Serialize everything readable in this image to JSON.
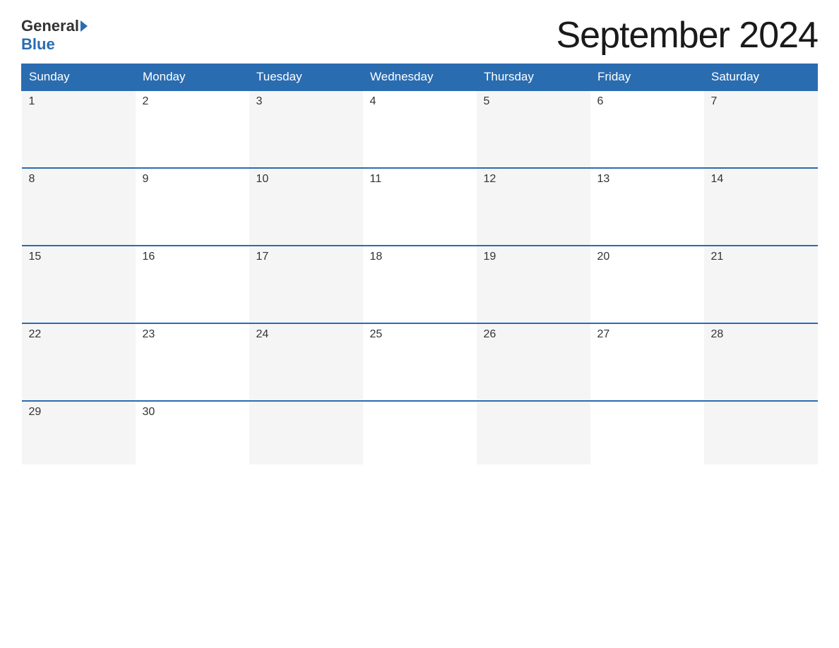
{
  "logo": {
    "general": "General",
    "blue": "Blue"
  },
  "title": "September 2024",
  "header": {
    "days": [
      "Sunday",
      "Monday",
      "Tuesday",
      "Wednesday",
      "Thursday",
      "Friday",
      "Saturday"
    ]
  },
  "weeks": [
    {
      "days": [
        {
          "date": "1",
          "empty": false
        },
        {
          "date": "2",
          "empty": false
        },
        {
          "date": "3",
          "empty": false
        },
        {
          "date": "4",
          "empty": false
        },
        {
          "date": "5",
          "empty": false
        },
        {
          "date": "6",
          "empty": false
        },
        {
          "date": "7",
          "empty": false
        }
      ]
    },
    {
      "days": [
        {
          "date": "8",
          "empty": false
        },
        {
          "date": "9",
          "empty": false
        },
        {
          "date": "10",
          "empty": false
        },
        {
          "date": "11",
          "empty": false
        },
        {
          "date": "12",
          "empty": false
        },
        {
          "date": "13",
          "empty": false
        },
        {
          "date": "14",
          "empty": false
        }
      ]
    },
    {
      "days": [
        {
          "date": "15",
          "empty": false
        },
        {
          "date": "16",
          "empty": false
        },
        {
          "date": "17",
          "empty": false
        },
        {
          "date": "18",
          "empty": false
        },
        {
          "date": "19",
          "empty": false
        },
        {
          "date": "20",
          "empty": false
        },
        {
          "date": "21",
          "empty": false
        }
      ]
    },
    {
      "days": [
        {
          "date": "22",
          "empty": false
        },
        {
          "date": "23",
          "empty": false
        },
        {
          "date": "24",
          "empty": false
        },
        {
          "date": "25",
          "empty": false
        },
        {
          "date": "26",
          "empty": false
        },
        {
          "date": "27",
          "empty": false
        },
        {
          "date": "28",
          "empty": false
        }
      ]
    },
    {
      "days": [
        {
          "date": "29",
          "empty": false
        },
        {
          "date": "30",
          "empty": false
        },
        {
          "date": "",
          "empty": true
        },
        {
          "date": "",
          "empty": true
        },
        {
          "date": "",
          "empty": true
        },
        {
          "date": "",
          "empty": true
        },
        {
          "date": "",
          "empty": true
        }
      ]
    }
  ]
}
